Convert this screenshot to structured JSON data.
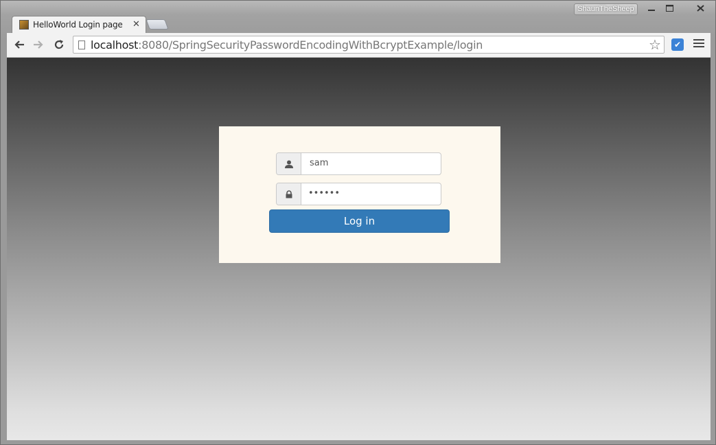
{
  "browser": {
    "profile_name": "ShaunTheSheep",
    "tab_title": "HelloWorld Login page",
    "url_host": "localhost",
    "url_rest": ":8080/SpringSecurityPasswordEncodingWithBcryptExample/login",
    "icons": {
      "back": "arrow-left-icon",
      "forward": "arrow-right-icon",
      "reload": "reload-icon",
      "bookmark": "star-icon",
      "extension": "checkmark-extension-icon",
      "menu": "hamburger-menu-icon"
    }
  },
  "login": {
    "username_value": "sam",
    "password_value": "••••••",
    "submit_label": "Log in",
    "accent_color": "#337ab7",
    "panel_color": "#fdf8ee"
  }
}
